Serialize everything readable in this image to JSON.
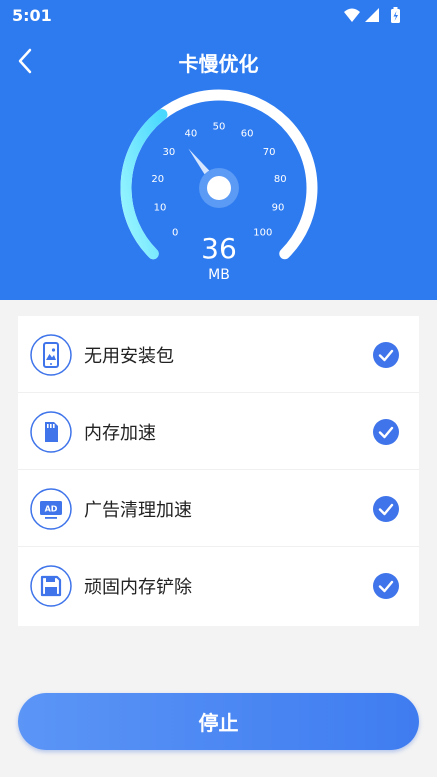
{
  "status_bar": {
    "time": "5:01",
    "icons": [
      "wifi-icon",
      "signal-icon",
      "battery-icon"
    ]
  },
  "header": {
    "title": "卡慢优化",
    "back_icon": "back-arrow-icon"
  },
  "gauge": {
    "value": "36",
    "unit": "MB",
    "ticks": [
      "0",
      "10",
      "20",
      "30",
      "40",
      "50",
      "60",
      "70",
      "80",
      "90",
      "100"
    ],
    "min": 0,
    "max": 100,
    "progress_colors": [
      "#9ff7ff",
      "#4ad8ff"
    ]
  },
  "tasks": [
    {
      "label": "无用安装包",
      "icon": "phone-image-icon",
      "checked": true
    },
    {
      "label": "内存加速",
      "icon": "sd-card-icon",
      "checked": true
    },
    {
      "label": "广告清理加速",
      "icon": "ad-icon",
      "checked": true
    },
    {
      "label": "顽固内存铲除",
      "icon": "floppy-disk-icon",
      "checked": true
    }
  ],
  "stop_button": {
    "label": "停止"
  },
  "colors": {
    "primary": "#2e7bf0",
    "check": "#3f74ea",
    "background": "#f3f3f3"
  }
}
